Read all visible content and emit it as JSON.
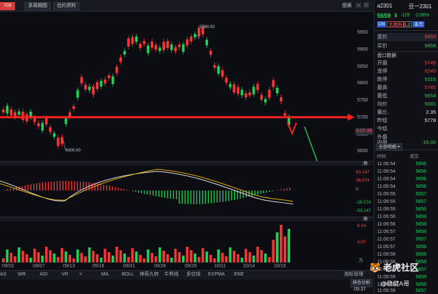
{
  "toolbar": {
    "code_partial": "709",
    "multi_period": "多周期图",
    "contract_info": "合约资料",
    "window_title": "图表"
  },
  "price_axis": [
    "5950",
    "5900",
    "5850",
    "5800",
    "5750",
    "5700",
    "5650",
    "5600"
  ],
  "chart_labels": {
    "high_marker": "5960.00",
    "low_marker": "5600.00",
    "countdown": "0:07:49",
    "current_price_tag": "5700"
  },
  "macd_axis": [
    "53.147",
    "26.574",
    "0",
    "-26.574",
    "-53.147"
  ],
  "vol_axis": [
    "6.14",
    "3.07",
    "万"
  ],
  "dates": [
    "09/02",
    "09/07",
    "09/13",
    "09/16",
    "09/21",
    "09/26",
    "09/29",
    "10/11",
    "10/14",
    "10/19"
  ],
  "indicator_tabs_left": [
    "AS",
    "WR",
    "ASI",
    "VR"
  ],
  "indicator_tabs_main": [
    "MA",
    "BOLL",
    "神奇九转",
    "牛熊线",
    "多空线",
    "EXPMA",
    "ENE"
  ],
  "indicator_manage": "指标管理",
  "position_analysis": "持仓分析",
  "quote": {
    "code": "a2301",
    "name": "豆一2301",
    "price": "5659",
    "change": "-119",
    "change_pct": "-2.06%",
    "badge_cn": "CN",
    "badge_exchange": "大商所",
    "badge_level": "L2",
    "badge_main": "主力"
  },
  "order_book": [
    {
      "label": "卖价",
      "value": "5659"
    },
    {
      "label": "买价",
      "value": "5658"
    }
  ],
  "section_title": "盘口数据",
  "stats": [
    {
      "label": "开盘",
      "value": "5745",
      "color": "red"
    },
    {
      "label": "涨停",
      "value": "6240",
      "color": "red"
    },
    {
      "label": "跌停",
      "value": "5316",
      "color": "green"
    },
    {
      "label": "最高",
      "value": "5745",
      "color": "red"
    },
    {
      "label": "最低",
      "value": "5654",
      "color": "green"
    },
    {
      "label": "均价",
      "value": "5691",
      "color": "green"
    },
    {
      "label": "量比",
      "value": "2.35",
      "color": "white"
    },
    {
      "label": "昨结",
      "value": "5778",
      "color": "white"
    },
    {
      "label": "今结",
      "value": "",
      "color": "white"
    },
    {
      "label": "外盘",
      "value": "",
      "color": "white"
    },
    {
      "label": "内盘",
      "value": "-19.00",
      "color": "green"
    }
  ],
  "ticks_header": {
    "filter": "全部明细",
    "time": "时间",
    "price": "成交"
  },
  "ticks": [
    {
      "time": "11:06:54",
      "price": "5656"
    },
    {
      "time": "11:06:54",
      "price": "5656"
    },
    {
      "time": "11:06:54",
      "price": "5656"
    },
    {
      "time": "11:06:54",
      "price": "5656"
    },
    {
      "time": "11:06:55",
      "price": "5657"
    },
    {
      "time": "11:06:55",
      "price": "5657"
    },
    {
      "time": "11:06:55",
      "price": "5656"
    },
    {
      "time": "11:06:56",
      "price": "5658"
    },
    {
      "time": "11:06:56",
      "price": "5658"
    },
    {
      "time": "11:06:57",
      "price": "5658"
    },
    {
      "time": "11:06:57",
      "price": "5657"
    },
    {
      "time": "11:06:57",
      "price": "5658"
    },
    {
      "time": "11:06:58",
      "price": "5658"
    },
    {
      "time": "11:06:58",
      "price": "5658"
    },
    {
      "time": "11:06:58",
      "price": "5657"
    },
    {
      "time": "11:06:59",
      "price": "5658"
    },
    {
      "time": "11:06:59",
      "price": "5658"
    },
    {
      "time": "11:06:59",
      "price": "5657"
    }
  ],
  "clock": "09:37",
  "watermark_main": "老虎社区",
  "watermark_user": "@稳健A哥"
}
